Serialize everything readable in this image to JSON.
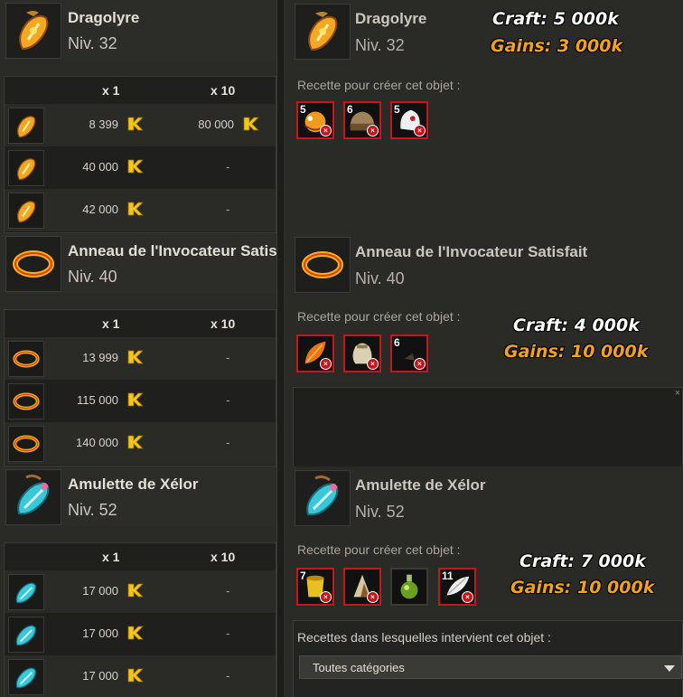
{
  "items": [
    {
      "name": "Dragolyre",
      "name_right": "Dragolyre",
      "level": "Niv. 32",
      "icon": "dragolyre-amulet-icon",
      "col_x1": "x 1",
      "col_x10": "x 10",
      "prices": [
        {
          "x1": "8 399",
          "x10": "80 000"
        },
        {
          "x1": "40 000",
          "x10": "-"
        },
        {
          "x1": "42 000",
          "x10": "-"
        }
      ],
      "recipe_label": "Recette pour créer cet objet :",
      "ingredients": [
        {
          "qty": "5",
          "icon": "orange-creature-icon"
        },
        {
          "qty": "6",
          "icon": "leather-bag-icon"
        },
        {
          "qty": "5",
          "icon": "white-skull-icon"
        }
      ],
      "craft": "Craft: 5 000k",
      "gains": "Gains: 3 000k"
    },
    {
      "name": "Anneau de l'Invocateur Satisfait",
      "name_right": "Anneau de l'Invocateur Satisfait",
      "level": "Niv. 40",
      "icon": "gold-ring-icon",
      "col_x1": "x 1",
      "col_x10": "x 10",
      "prices": [
        {
          "x1": "13 999",
          "x10": "-"
        },
        {
          "x1": "115 000",
          "x10": "-"
        },
        {
          "x1": "140 000",
          "x10": "-"
        }
      ],
      "recipe_label": "Recette pour créer cet objet :",
      "ingredients": [
        {
          "qty": "",
          "icon": "orange-leaf-icon"
        },
        {
          "qty": "",
          "icon": "sack-icon"
        },
        {
          "qty": "6",
          "icon": "dark-shard-icon"
        }
      ],
      "craft": "Craft: 4 000k",
      "gains": "Gains: 10 000k"
    },
    {
      "name": "Amulette de Xélor",
      "name_right": "Amulette de Xélor",
      "level": "Niv. 52",
      "icon": "blue-amulet-icon",
      "col_x1": "x 1",
      "col_x10": "x 10",
      "prices": [
        {
          "x1": "17 000",
          "x10": "-"
        },
        {
          "x1": "17 000",
          "x10": "-"
        },
        {
          "x1": "17 000",
          "x10": "-"
        }
      ],
      "recipe_label": "Recette pour créer cet objet :",
      "ingredients": [
        {
          "qty": "7",
          "icon": "yellow-pot-icon"
        },
        {
          "qty": "",
          "icon": "brown-horn-icon"
        },
        {
          "qty": "",
          "icon": "green-potion-icon"
        },
        {
          "qty": "11",
          "icon": "white-feather-icon"
        }
      ],
      "craft": "Craft: 7 000k",
      "gains": "Gains: 10 000k",
      "uses_label": "Recettes dans lesquelles intervient cet objet :",
      "category": "Toutes catégories"
    }
  ],
  "colors": {
    "accent_gold": "#f4a21a",
    "error_red": "#c4161c",
    "kama_yellow": "#f5c518"
  }
}
